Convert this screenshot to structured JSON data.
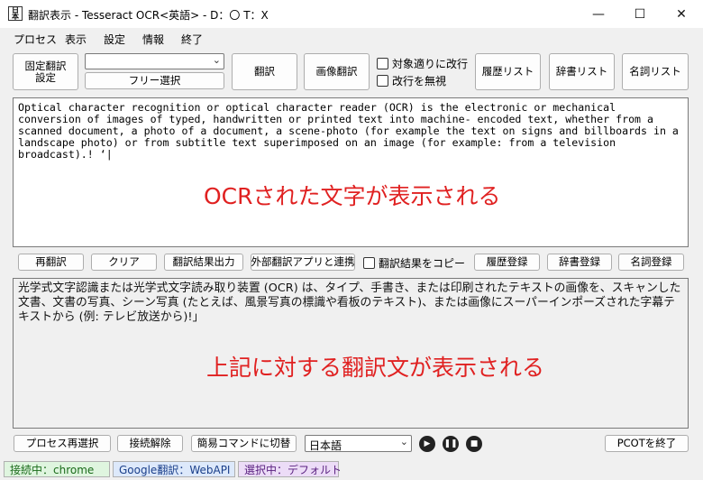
{
  "window": {
    "title": "翻訳表示 - Tesseract OCR<英語> - D：〇 T：X",
    "icon_text": "日本",
    "icon_name": "app-icon",
    "controls": {
      "minimize": "—",
      "maximize": "☐",
      "close": "✕"
    }
  },
  "menu": [
    "プロセス",
    "表示",
    "設定",
    "情報",
    "終了"
  ],
  "toolbar": {
    "fixed_translation_line1": "固定翻訳",
    "fixed_translation_line2": "設定",
    "dropdown_value": "",
    "free_select": "フリー選択",
    "translate": "翻訳",
    "image_translate": "画像翻訳",
    "line_break_label": "対象適りに改行",
    "ignore_line_break_label": "改行を無視",
    "history_list": "履歴リスト",
    "dictionary_list": "辞書リスト",
    "noun_list": "名詞リスト"
  },
  "ocr": {
    "text": "Optical character recognition or optical character reader (OCR) is the electronic or mechanical\nconversion of images of typed, handwritten or printed text into machine- encoded text, whether from a\nscanned document, a photo of a document, a scene-photo (for example the text on signs and billboards in a\nlandscape photo) or from subtitle text superimposed on an image (for example: from a television\nbroadcast).! ‘|",
    "overlay": "OCRされた文字が表示される"
  },
  "middle": {
    "retranslate": "再翻訳",
    "clear": "クリア",
    "export": "翻訳結果出力",
    "external_app": "外部翻訳アプリと連携",
    "copy_result_label": "翻訳結果をコピー",
    "history_register": "履歴登録",
    "dictionary_register": "辞書登録",
    "noun_register": "名詞登録"
  },
  "translation": {
    "text": "光学式文字認識または光学式文字読み取り装置 (OCR) は、タイプ、手書き、または印刷されたテキストの画像を、スキャンした文書、文書の写真、シーン写真 (たとえば、風景写真の標識や看板のテキスト)、または画像にスーパーインポーズされた字幕テキストから (例: テレビ放送から)!」",
    "overlay": "上記に対する翻訳文が表示される"
  },
  "bottom": {
    "process_reselect": "プロセス再選択",
    "disconnect": "接続解除",
    "simple_command": "簡易コマンドに切替",
    "language_value": "日本語",
    "play_icon": "play-icon",
    "pause_icon": "pause-icon",
    "stop_icon": "stop-icon",
    "exit": "PCOTを終了"
  },
  "status": {
    "connection": "接続中：chrome",
    "google": "Google翻訳：WebAPI",
    "selection": "選択中：デフォルト"
  },
  "colors": {
    "overlay_text": "#e02121",
    "status_connection_bg": "#dff5df",
    "status_google_bg": "#dde9fb",
    "status_selection_bg": "#ecdcf7",
    "textarea_top_bg": "#ffffff",
    "textarea_bottom_bg": "#f0f0f0"
  }
}
